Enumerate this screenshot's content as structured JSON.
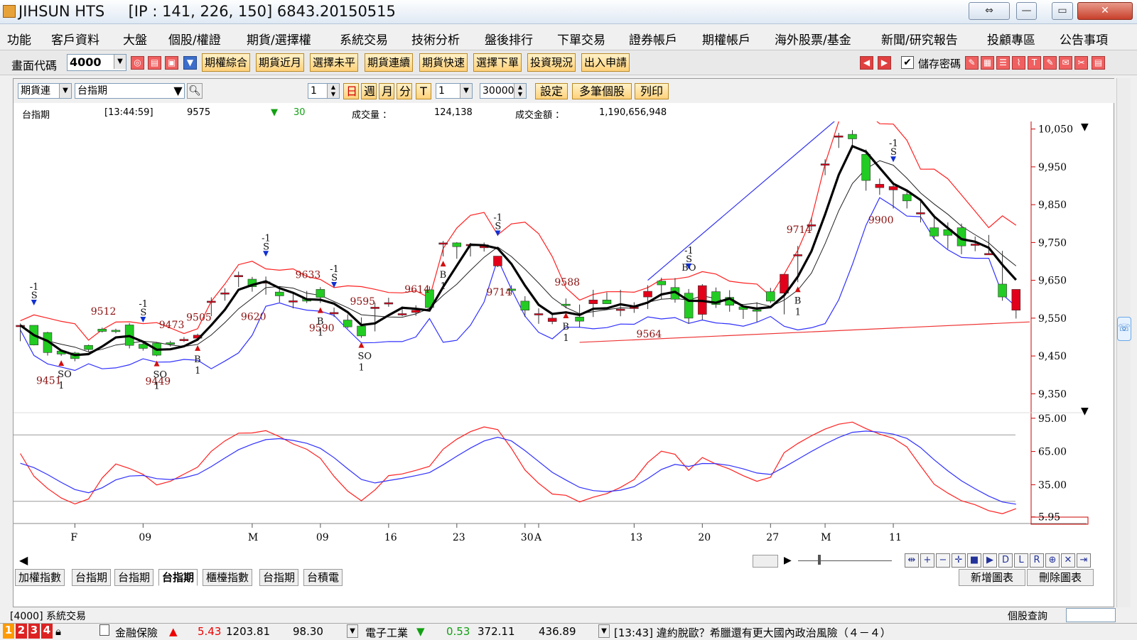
{
  "window": {
    "title": "JIHSUN HTS     [IP : 141, 226, 150] 6843.20150515",
    "btn_restore": "⇔",
    "btn_min": "—",
    "btn_max": "▭",
    "btn_close": "✕"
  },
  "menu": [
    "功能",
    "客戶資料",
    "大盤",
    "個股/權證",
    "期貨/選擇權",
    "系統交易",
    "技術分析",
    "盤後排行",
    "下單交易",
    "證券帳戶",
    "期權帳戶",
    "海外股票/基金",
    "新聞/研究報告",
    "投顧專區",
    "公告事項"
  ],
  "toolbar": {
    "code_label": "畫面代碼",
    "code_value": "4000",
    "buttons": [
      "期權綜合",
      "期貨近月",
      "選擇未平",
      "期貨連續",
      "期貨快速",
      "選擇下單",
      "投資現況",
      "出入申請"
    ],
    "save_pwd_label": "儲存密碼"
  },
  "chart_toolbar": {
    "type_select": "期貨連",
    "symbol": "台指期",
    "count1": "1",
    "period_buttons": [
      "日",
      "週",
      "月",
      "分",
      "T"
    ],
    "count2": "1",
    "bars": "30000",
    "settings": "設定",
    "multi": "多筆個股",
    "print": "列印"
  },
  "info": {
    "name": "台指期",
    "time": "[13:44:59]",
    "price": "9575",
    "change_arrow": "▼",
    "change": "30",
    "volume_label": "成交量 ：",
    "volume": "124,138",
    "amount_label": "成交金額 ：",
    "amount": "1,190,656,948"
  },
  "chart_data": {
    "type": "candlestick",
    "price_axis": {
      "ticks": [
        "10,050",
        "9,950",
        "9,850",
        "9,750",
        "9,650",
        "9,550",
        "9,450",
        "9,350"
      ],
      "range": [
        9300,
        10070
      ]
    },
    "osc_axis": {
      "ticks": [
        "95.00",
        "65.00",
        "35.00",
        "5.95"
      ],
      "range": [
        0,
        100
      ]
    },
    "x_ticks": [
      "F",
      "09",
      "M",
      "09",
      "16",
      "23",
      "30",
      "A",
      "13",
      "20",
      "27",
      "M",
      "11"
    ],
    "candles": [
      {
        "o": 9531,
        "h": 9536,
        "l": 9489,
        "c": 9531
      },
      {
        "o": 9531,
        "h": 9531,
        "l": 9478,
        "c": 9479
      },
      {
        "o": 9512,
        "h": 9514,
        "l": 9451,
        "c": 9459
      },
      {
        "o": 9463,
        "h": 9467,
        "l": 9450,
        "c": 9455
      },
      {
        "o": 9458,
        "h": 9461,
        "l": 9436,
        "c": 9443
      },
      {
        "o": 9478,
        "h": 9480,
        "l": 9462,
        "c": 9467
      },
      {
        "o": 9521,
        "h": 9525,
        "l": 9512,
        "c": 9515
      },
      {
        "o": 9518,
        "h": 9522,
        "l": 9510,
        "c": 9515
      },
      {
        "o": 9532,
        "h": 9537,
        "l": 9470,
        "c": 9478
      },
      {
        "o": 9481,
        "h": 9486,
        "l": 9464,
        "c": 9470
      },
      {
        "o": 9484,
        "h": 9487,
        "l": 9449,
        "c": 9452
      },
      {
        "o": 9485,
        "h": 9490,
        "l": 9475,
        "c": 9481
      },
      {
        "o": 9494,
        "h": 9500,
        "l": 9487,
        "c": 9494
      },
      {
        "o": 9497,
        "h": 9509,
        "l": 9490,
        "c": 9505
      },
      {
        "o": 9595,
        "h": 9605,
        "l": 9555,
        "c": 9595
      },
      {
        "o": 9617,
        "h": 9629,
        "l": 9596,
        "c": 9617
      },
      {
        "o": 9663,
        "h": 9673,
        "l": 9632,
        "c": 9663
      },
      {
        "o": 9653,
        "h": 9659,
        "l": 9620,
        "c": 9633
      },
      {
        "o": 9646,
        "h": 9660,
        "l": 9612,
        "c": 9646
      },
      {
        "o": 9619,
        "h": 9633,
        "l": 9592,
        "c": 9609
      },
      {
        "o": 9596,
        "h": 9617,
        "l": 9576,
        "c": 9596
      },
      {
        "o": 9602,
        "h": 9622,
        "l": 9590,
        "c": 9595
      },
      {
        "o": 9626,
        "h": 9632,
        "l": 9590,
        "c": 9605
      },
      {
        "o": 9565,
        "h": 9578,
        "l": 9553,
        "c": 9565
      },
      {
        "o": 9545,
        "h": 9560,
        "l": 9523,
        "c": 9527
      },
      {
        "o": 9529,
        "h": 9552,
        "l": 9498,
        "c": 9503
      },
      {
        "o": 9579,
        "h": 9591,
        "l": 9515,
        "c": 9579
      },
      {
        "o": 9591,
        "h": 9604,
        "l": 9580,
        "c": 9591
      },
      {
        "o": 9562,
        "h": 9581,
        "l": 9555,
        "c": 9562
      },
      {
        "o": 9565,
        "h": 9584,
        "l": 9556,
        "c": 9571
      },
      {
        "o": 9625,
        "h": 9634,
        "l": 9576,
        "c": 9578
      },
      {
        "o": 9749,
        "h": 9754,
        "l": 9713,
        "c": 9749
      },
      {
        "o": 9749,
        "h": 9751,
        "l": 9707,
        "c": 9739
      },
      {
        "o": 9745,
        "h": 9749,
        "l": 9713,
        "c": 9745
      },
      {
        "o": 9736,
        "h": 9750,
        "l": 9726,
        "c": 9744
      },
      {
        "o": 9688,
        "h": 9714,
        "l": 9685,
        "c": 9714
      },
      {
        "o": 9627,
        "h": 9637,
        "l": 9612,
        "c": 9623
      },
      {
        "o": 9595,
        "h": 9608,
        "l": 9553,
        "c": 9571
      },
      {
        "o": 9562,
        "h": 9576,
        "l": 9535,
        "c": 9562
      },
      {
        "o": 9541,
        "h": 9559,
        "l": 9534,
        "c": 9550
      },
      {
        "o": 9587,
        "h": 9602,
        "l": 9576,
        "c": 9584
      },
      {
        "o": 9553,
        "h": 9586,
        "l": 9525,
        "c": 9542
      },
      {
        "o": 9588,
        "h": 9625,
        "l": 9553,
        "c": 9598
      },
      {
        "o": 9598,
        "h": 9618,
        "l": 9588,
        "c": 9588
      },
      {
        "o": 9574,
        "h": 9625,
        "l": 9555,
        "c": 9574
      },
      {
        "o": 9579,
        "h": 9592,
        "l": 9564,
        "c": 9579
      },
      {
        "o": 9606,
        "h": 9637,
        "l": 9574,
        "c": 9621
      },
      {
        "o": 9648,
        "h": 9657,
        "l": 9600,
        "c": 9638
      },
      {
        "o": 9631,
        "h": 9656,
        "l": 9591,
        "c": 9600
      },
      {
        "o": 9616,
        "h": 9627,
        "l": 9535,
        "c": 9550
      },
      {
        "o": 9560,
        "h": 9640,
        "l": 9546,
        "c": 9636
      },
      {
        "o": 9620,
        "h": 9631,
        "l": 9577,
        "c": 9586
      },
      {
        "o": 9605,
        "h": 9624,
        "l": 9567,
        "c": 9584
      },
      {
        "o": 9580,
        "h": 9583,
        "l": 9548,
        "c": 9573
      },
      {
        "o": 9572,
        "h": 9592,
        "l": 9540,
        "c": 9569
      },
      {
        "o": 9620,
        "h": 9630,
        "l": 9590,
        "c": 9595
      },
      {
        "o": 9616,
        "h": 9653,
        "l": 9560,
        "c": 9666
      },
      {
        "o": 9718,
        "h": 9741,
        "l": 9645,
        "c": 9718
      },
      {
        "o": 9797,
        "h": 9816,
        "l": 9782,
        "c": 9797
      },
      {
        "o": 9958,
        "h": 9970,
        "l": 9928,
        "c": 9958
      },
      {
        "o": 10032,
        "h": 10040,
        "l": 10000,
        "c": 10032
      },
      {
        "o": 10036,
        "h": 10047,
        "l": 10005,
        "c": 10024
      },
      {
        "o": 9983,
        "h": 9996,
        "l": 9887,
        "c": 9914
      },
      {
        "o": 9895,
        "h": 9919,
        "l": 9876,
        "c": 9904
      },
      {
        "o": 9889,
        "h": 9910,
        "l": 9840,
        "c": 9898
      },
      {
        "o": 9877,
        "h": 9890,
        "l": 9840,
        "c": 9860
      },
      {
        "o": 9829,
        "h": 9858,
        "l": 9803,
        "c": 9829
      },
      {
        "o": 9789,
        "h": 9824,
        "l": 9760,
        "c": 9767
      },
      {
        "o": 9784,
        "h": 9803,
        "l": 9733,
        "c": 9769
      },
      {
        "o": 9789,
        "h": 9800,
        "l": 9719,
        "c": 9741
      },
      {
        "o": 9746,
        "h": 9766,
        "l": 9727,
        "c": 9746
      },
      {
        "o": 9721,
        "h": 9770,
        "l": 9721,
        "c": 9721
      },
      {
        "o": 9640,
        "h": 9728,
        "l": 9596,
        "c": 9606
      },
      {
        "o": 9571,
        "h": 9626,
        "l": 9549,
        "c": 9626
      }
    ],
    "annotations": [
      "9451",
      "9512",
      "9449",
      "9473",
      "9505",
      "9620",
      "9633",
      "9590",
      "9595",
      "9614",
      "9714",
      "9588",
      "9564",
      "9714",
      "9900"
    ],
    "signals": [
      "-1",
      "S",
      "SO",
      "0",
      "B",
      "1",
      "BO"
    ]
  },
  "tabs": [
    "加權指數",
    "台指期",
    "台指期",
    "台指期",
    "櫃檯指數",
    "台指期",
    "台積電"
  ],
  "active_tab": 3,
  "chart_right": {
    "add": "新增圖表",
    "remove": "刪除圖表"
  },
  "nav_buttons": [
    "⇹",
    "+",
    "−",
    "✛",
    "■",
    "▶",
    "D",
    "L",
    "R",
    "⊕",
    "✕",
    "⇥"
  ],
  "status": {
    "left": "[4000]  系統交易",
    "right": "個股查詢"
  },
  "ticker": {
    "nums": [
      "1",
      "2",
      "3",
      "4"
    ],
    "sector1": "金融保險",
    "arrow1": "▲",
    "chg1": "5.43",
    "val1": "1203.81",
    "last1": "98.30",
    "sector2": "電子工業",
    "arrow2": "▼",
    "chg2": "0.53",
    "val2": "372.11",
    "last2": "436.89",
    "news": "[13:43]  違約脫歐？希臘還有更大國內政治風險（４－４）"
  },
  "colors": {
    "up": "#e2001a",
    "down": "#22cc22",
    "ma_red": "#ff2020",
    "ma_blue": "#3030ff",
    "accent": "#ffd17a"
  }
}
